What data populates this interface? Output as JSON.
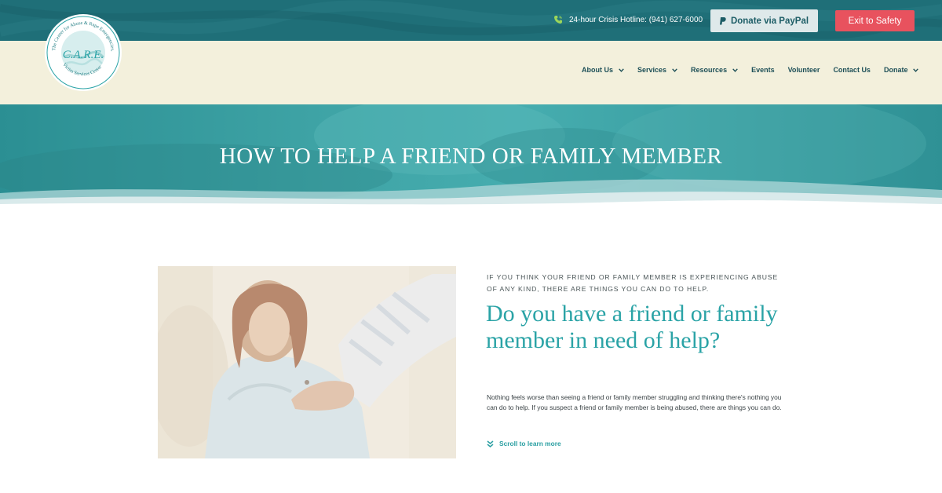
{
  "topbar": {
    "hotline_label": "24-hour Crisis Hotline: (941) 627-6000",
    "paypal_label": "Donate via PayPal",
    "exit_label": "Exit to Safety",
    "phone_icon": "phone-icon",
    "paypal_icon": "paypal-icon"
  },
  "logo": {
    "ring_text_top": "The Center for Abuse & Rape Emergencies, Inc.",
    "ring_text_bottom": "Victim Services Center",
    "monogram": "C.A.R.E."
  },
  "nav": {
    "items": [
      {
        "label": "About Us",
        "has_dropdown": true
      },
      {
        "label": "Services",
        "has_dropdown": true
      },
      {
        "label": "Resources",
        "has_dropdown": true
      },
      {
        "label": "Events",
        "has_dropdown": false
      },
      {
        "label": "Volunteer",
        "has_dropdown": false
      },
      {
        "label": "Contact Us",
        "has_dropdown": false
      },
      {
        "label": "Donate",
        "has_dropdown": true
      }
    ]
  },
  "hero": {
    "title": "HOW TO HELP A FRIEND OR FAMILY MEMBER"
  },
  "content": {
    "eyebrow": "IF YOU THINK YOUR FRIEND OR FAMILY MEMBER IS EXPERIENCING ABUSE OF ANY KIND, THERE ARE THINGS YOU CAN DO TO HELP.",
    "headline": "Do you have a friend or family member in need of help?",
    "body": "Nothing feels worse than seeing a friend or family member struggling and thinking there's nothing you can do to help. If you suspect a friend or family member is being abused, there are things you can do.",
    "scroll_label": "Scroll to learn more",
    "scroll_icon": "double-chevron-down-icon"
  },
  "colors": {
    "topbar": "#1f6f78",
    "navband": "#f3f0dc",
    "accent": "#2aa3a6",
    "exit": "#e8525e",
    "paypal_bg": "#dfe9ea"
  }
}
